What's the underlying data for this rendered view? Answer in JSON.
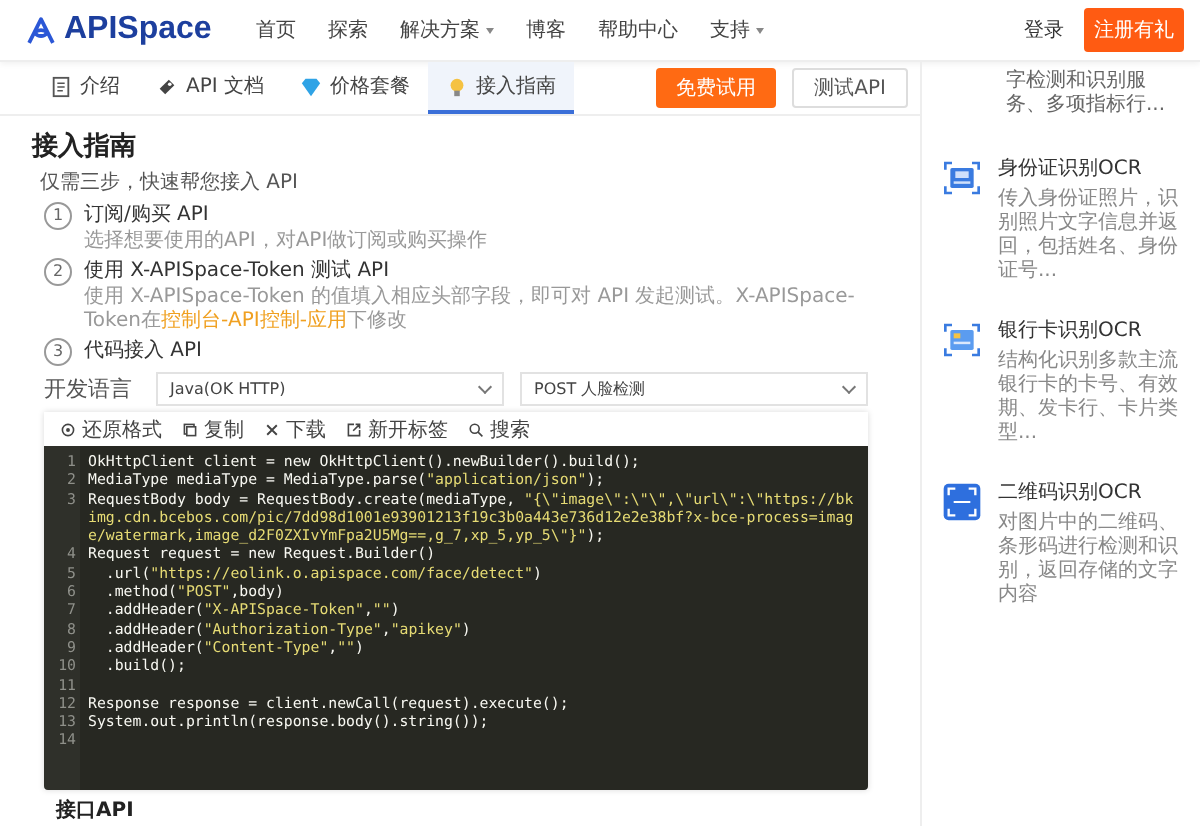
{
  "header": {
    "logo": "APISpace",
    "nav": [
      {
        "label": "首页",
        "dropdown": false
      },
      {
        "label": "探索",
        "dropdown": false
      },
      {
        "label": "解决方案",
        "dropdown": true
      },
      {
        "label": "博客",
        "dropdown": false
      },
      {
        "label": "帮助中心",
        "dropdown": false
      },
      {
        "label": "支持",
        "dropdown": true
      }
    ],
    "login": "登录",
    "register": "注册有礼"
  },
  "tabs": [
    {
      "label": "介绍",
      "selected": false
    },
    {
      "label": "API 文档",
      "selected": false
    },
    {
      "label": "价格套餐",
      "selected": false
    },
    {
      "label": "接入指南",
      "selected": true
    }
  ],
  "actions": [
    {
      "label": "免费试用",
      "kind": "primary"
    },
    {
      "label": "测试API",
      "kind": "secondary"
    }
  ],
  "guide": {
    "title": "接入指南",
    "intro": "仅需三步，快速帮您接入 API",
    "steps": [
      {
        "number": "1",
        "title": "订阅/购买 API",
        "description": "选择想要使用的API，对API做订阅或购买操作"
      },
      {
        "number": "2",
        "title": "使用 X-APISpace-Token 测试 API",
        "description": "使用 X-APISpace-Token 的值填入相应头部字段，即可对 API 发起测试。X-APISpace-Token在",
        "link": "控制台-API控制-应用",
        "suffix": "下修改"
      },
      {
        "number": "3",
        "title": "代码接入 API"
      }
    ]
  },
  "language": {
    "label": "开发语言",
    "language_select": "Java(OK HTTP)",
    "endpoint_select": "POST 人脸检测"
  },
  "editor": {
    "toolbar": [
      "还原格式",
      "复制",
      "下载",
      "新开标签",
      "搜索"
    ],
    "lines": [
      {
        "number": "1",
        "code": "OkHttpClient client = new OkHttpClient().newBuilder().build();"
      },
      {
        "number": "2",
        "code": "MediaType mediaType = MediaType.parse(\"application/json\");"
      },
      {
        "number": "3",
        "code": "RequestBody body = RequestBody.create(mediaType, \"{\\\"image\\\":\\\"\\\",\\\"url\\\":\\\"https://bkimg.cdn.bcebos.com/pic/7dd98d1001e93901213f19c3b0a443e736d12e2e38bf?x-bce-process=image/watermark,image_d2F0ZXIvYmFpa2U5Mg==,g_7,xp_5,yp_5\\\"}\");"
      },
      {
        "number": "4",
        "code": "Request request = new Request.Builder()"
      },
      {
        "number": "5",
        "code": "  .url(\"https://eolink.o.apispace.com/face/detect\")"
      },
      {
        "number": "6",
        "code": "  .method(\"POST\",body)"
      },
      {
        "number": "7",
        "code": "  .addHeader(\"X-APISpace-Token\",\"\")"
      },
      {
        "number": "8",
        "code": "  .addHeader(\"Authorization-Type\",\"apikey\")"
      },
      {
        "number": "9",
        "code": "  .addHeader(\"Content-Type\",\"\")"
      },
      {
        "number": "10",
        "code": "  .build();"
      },
      {
        "number": "11"
      },
      {
        "number": "12",
        "code": "Response response = client.newCall(request).execute();"
      },
      {
        "number": "13",
        "code": "System.out.println(response.body().string());"
      },
      {
        "number": "14"
      }
    ]
  },
  "footer_text": "接口API",
  "sidebar": {
    "top_text": "字检测和识别服务、多项指标行...",
    "items": [
      {
        "title": "身份证识别OCR",
        "description": "传入身份证照片，识别照片文字信息并返回，包括姓名、身份证号..."
      },
      {
        "title": "银行卡识别OCR",
        "description": "结构化识别多款主流银行卡的卡号、有效期、发卡行、卡片类型..."
      },
      {
        "title": "二维码识别OCR",
        "description": "对图片中的二维码、条形码进行检测和识别，返回存储的文字内容"
      }
    ]
  }
}
